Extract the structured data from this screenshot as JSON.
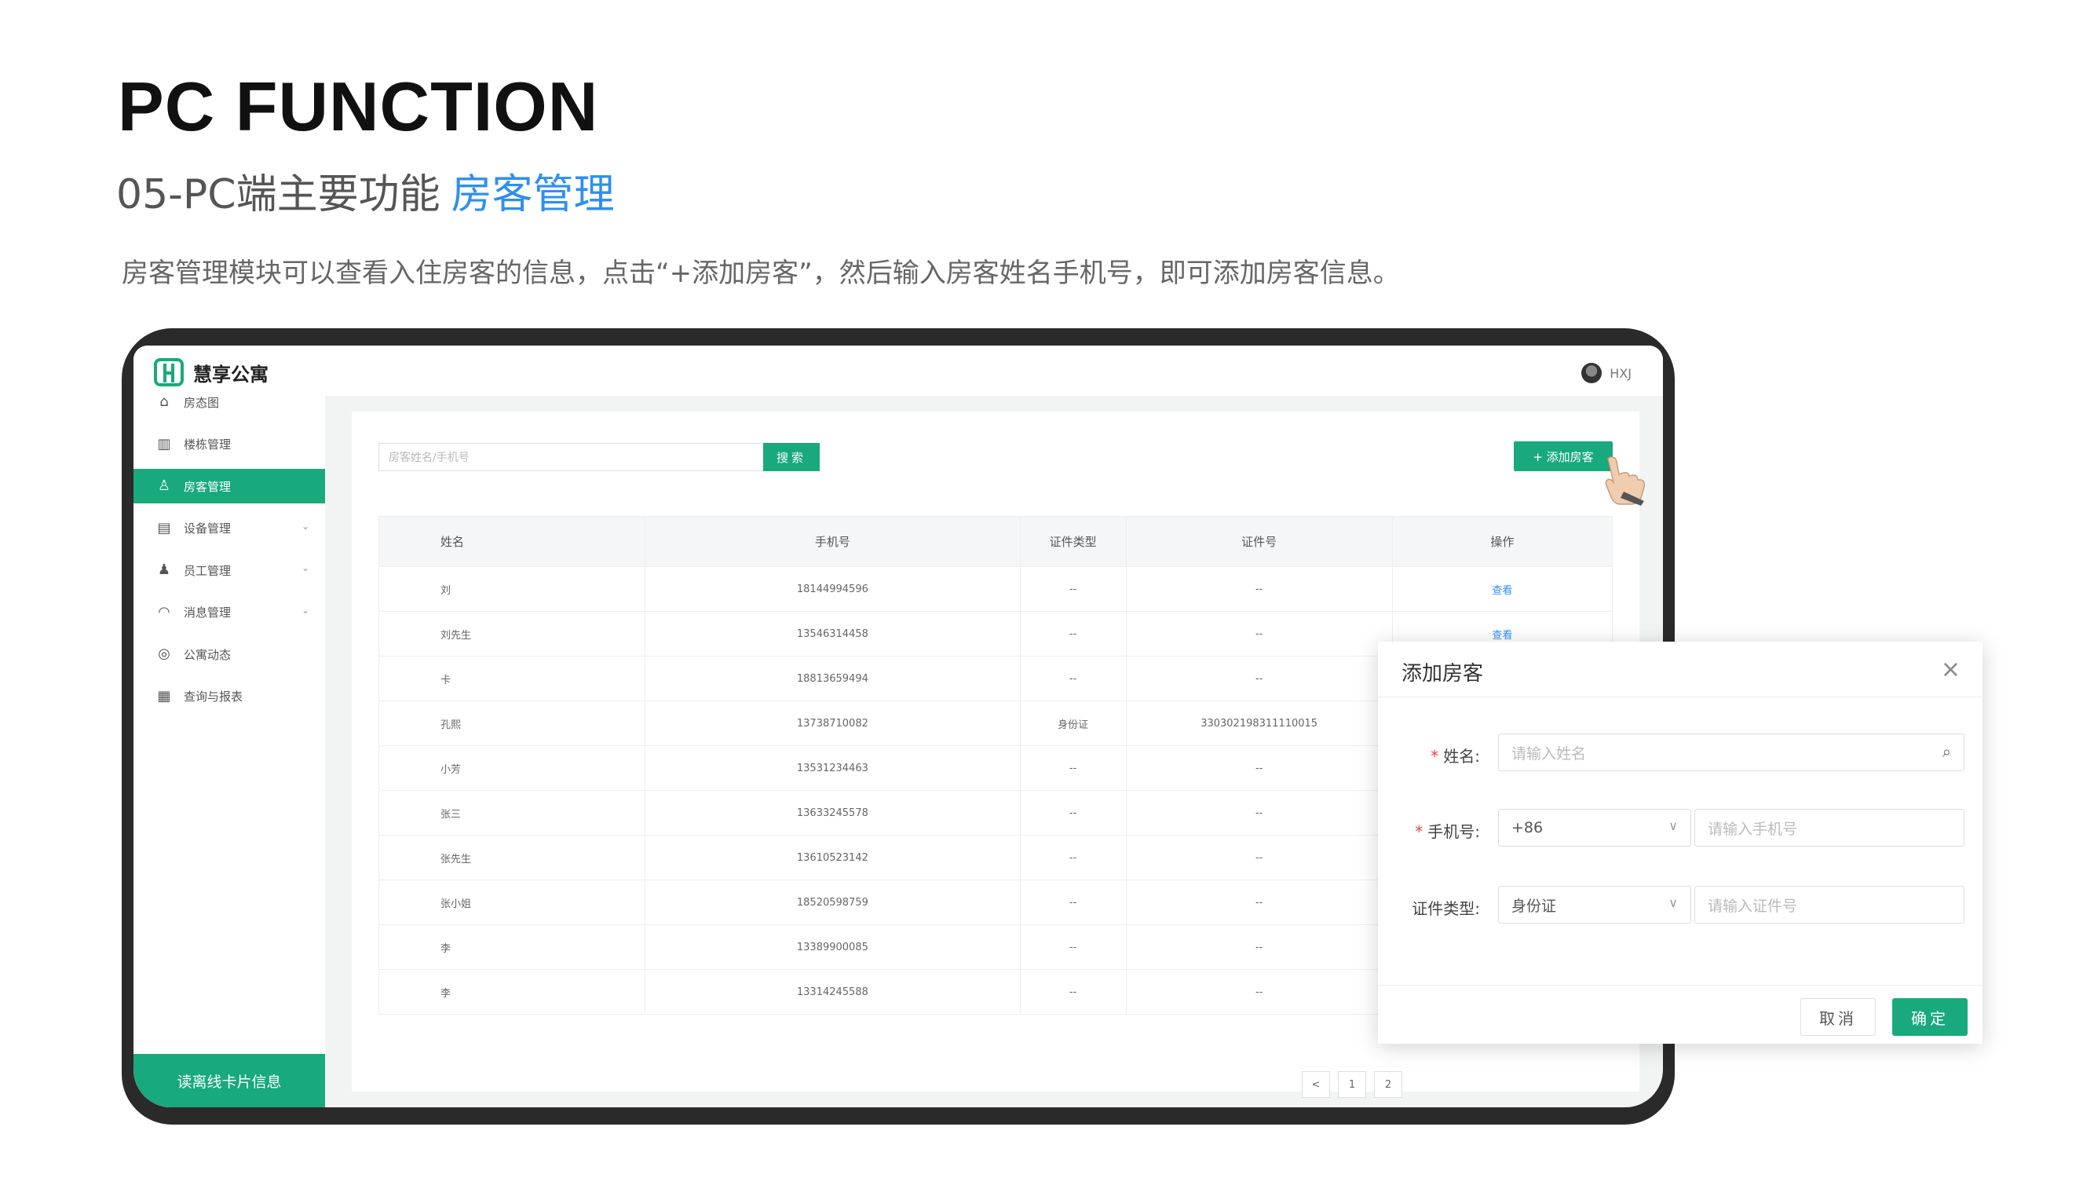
{
  "page": {
    "title": "PC FUNCTION",
    "subtitle": "05-PC端主要功能",
    "subtitle_accent": "房客管理",
    "description": "房客管理模块可以查看入住房客的信息，点击“+添加房客”，然后输入房客姓名手机号，即可添加房客信息。"
  },
  "app": {
    "logo_text": "慧享公寓",
    "user_name": "HXJ",
    "accent_color": "#18a97d",
    "link_color": "#2f8ff0"
  },
  "sidebar": {
    "items": [
      {
        "label": "房态图",
        "icon": "home-icon",
        "glyph": "⌂",
        "active": false,
        "expandable": false
      },
      {
        "label": "楼栋管理",
        "icon": "building-icon",
        "glyph": "▥",
        "active": false,
        "expandable": false
      },
      {
        "label": "房客管理",
        "icon": "user-icon",
        "glyph": "♙",
        "active": true,
        "expandable": false
      },
      {
        "label": "设备管理",
        "icon": "device-icon",
        "glyph": "▤",
        "active": false,
        "expandable": true
      },
      {
        "label": "员工管理",
        "icon": "staff-icon",
        "glyph": "♟",
        "active": false,
        "expandable": true
      },
      {
        "label": "消息管理",
        "icon": "bell-icon",
        "glyph": "◠",
        "active": false,
        "expandable": true
      },
      {
        "label": "公寓动态",
        "icon": "compass-icon",
        "glyph": "◎",
        "active": false,
        "expandable": false
      },
      {
        "label": "查询与报表",
        "icon": "report-icon",
        "glyph": "▦",
        "active": false,
        "expandable": false
      }
    ],
    "chevron": "⌄",
    "card_button": "读离线卡片信息"
  },
  "toolbar": {
    "search_placeholder": "房客姓名/手机号",
    "search_label": "搜索",
    "add_label": "+ 添加房客"
  },
  "table": {
    "headers": [
      "姓名",
      "手机号",
      "证件类型",
      "证件号",
      "操作"
    ],
    "rows": [
      [
        "刘",
        "18144994596",
        "--",
        "--",
        "查看"
      ],
      [
        "刘先生",
        "13546314458",
        "--",
        "--",
        "查看"
      ],
      [
        "卡",
        "18813659494",
        "--",
        "--",
        ""
      ],
      [
        "孔熙",
        "13738710082",
        "身份证",
        "330302198311110015",
        ""
      ],
      [
        "小芳",
        "13531234463",
        "--",
        "--",
        ""
      ],
      [
        "张三",
        "13633245578",
        "--",
        "--",
        ""
      ],
      [
        "张先生",
        "13610523142",
        "--",
        "--",
        ""
      ],
      [
        "张小姐",
        "18520598759",
        "--",
        "--",
        ""
      ],
      [
        "李",
        "13389900085",
        "--",
        "--",
        ""
      ],
      [
        "李",
        "13314245588",
        "--",
        "--",
        ""
      ]
    ]
  },
  "pager": {
    "prev": "<",
    "page1": "1",
    "page2": "2"
  },
  "dialog": {
    "title": "添加房客",
    "close": "×",
    "name_label": "姓名:",
    "name_placeholder": "请输入姓名",
    "phone_label": "手机号:",
    "phone_prefix": "+86",
    "phone_placeholder": "请输入手机号",
    "id_label": "证件类型:",
    "id_type": "身份证",
    "id_placeholder": "请输入证件号",
    "required_mark": "*",
    "cancel": "取消",
    "ok": "确定"
  }
}
